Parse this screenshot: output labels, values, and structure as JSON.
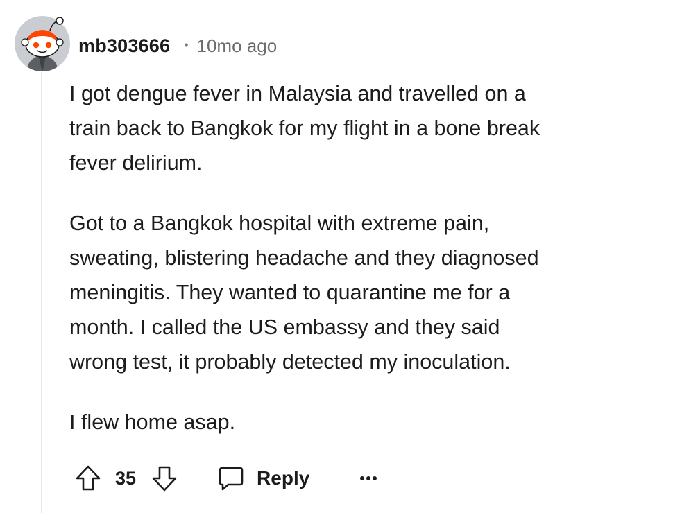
{
  "comment": {
    "author": "mb303666",
    "separator": "•",
    "timestamp": "10mo ago",
    "avatar_icon": "reddit-snoo-avatar-icon",
    "paragraphs": [
      "I got dengue fever in Malaysia and travelled on a\ntrain back to Bangkok for my flight in a bone break\nfever delirium.",
      "Got to a Bangkok hospital with extreme pain,\nsweating, blistering headache and they diagnosed\nmeningitis. They wanted to quarantine me for a\nmonth. I called the US embassy and they said\nwrong test, it probably detected my inoculation.",
      "I flew home asap."
    ]
  },
  "actions": {
    "upvote_icon": "arrow-up-icon",
    "vote_count": "35",
    "downvote_icon": "arrow-down-icon",
    "reply_icon": "speech-bubble-icon",
    "reply_label": "Reply",
    "more_icon": "more-dots-icon"
  },
  "colors": {
    "text": "#1c1c1c",
    "meta": "#6a6d70",
    "thread_line": "#e6e9eb",
    "avatar_accent": "#ff4500",
    "avatar_bg": "#c9ccd0"
  }
}
